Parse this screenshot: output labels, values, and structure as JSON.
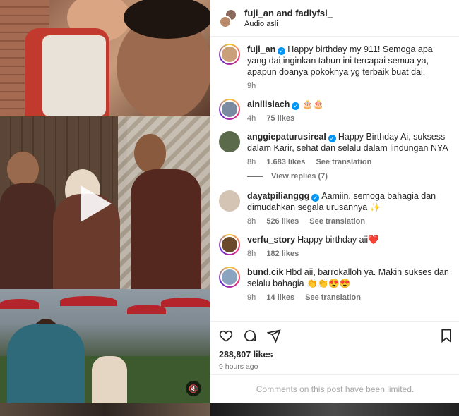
{
  "header": {
    "names": "fuji_an and fadlyfsl_",
    "audio": "Audio asli"
  },
  "caption": {
    "user": "fuji_an",
    "text": "Happy birthday my 911! Semoga apa yang dai inginkan tahun ini tercapai semua ya, apapun doanya pokoknya yg terbaik buat dai.",
    "time": "9h"
  },
  "comments": [
    {
      "user": "ainilislach",
      "verified": true,
      "text": "🎂🎂",
      "time": "4h",
      "likes": "75 likes",
      "translate": ""
    },
    {
      "user": "anggiepaturusireal",
      "verified": true,
      "text": "Happy Birthday Ai, suksess dalam Karir, sehat dan selalu dalam lindungan NYA",
      "time": "8h",
      "likes": "1.683 likes",
      "translate": "See translation"
    },
    {
      "user": "dayatpiliang​gg",
      "verified": true,
      "text": "Aamiin, semoga bahagia dan dimudahkan segala urusannya ✨",
      "time": "8h",
      "likes": "526 likes",
      "translate": "See translation"
    },
    {
      "user": "verfu_story",
      "verified": false,
      "text": "Happy birthday aii❤️",
      "time": "8h",
      "likes": "182 likes",
      "translate": ""
    },
    {
      "user": "bund.cik",
      "verified": false,
      "text": "Hbd aii, barrokalloh ya. Makin sukses dan selalu bahagia 👏👏😍😍",
      "time": "9h",
      "likes": "14 likes",
      "translate": "See translation"
    }
  ],
  "view_replies": "View replies (7)",
  "post": {
    "likes": "288,807 likes",
    "time": "9 hours ago",
    "limited": "Comments on this post have been limited."
  },
  "icons": [
    "heart-icon",
    "comment-icon",
    "share-icon",
    "bookmark-icon",
    "play-icon",
    "mute-icon"
  ]
}
